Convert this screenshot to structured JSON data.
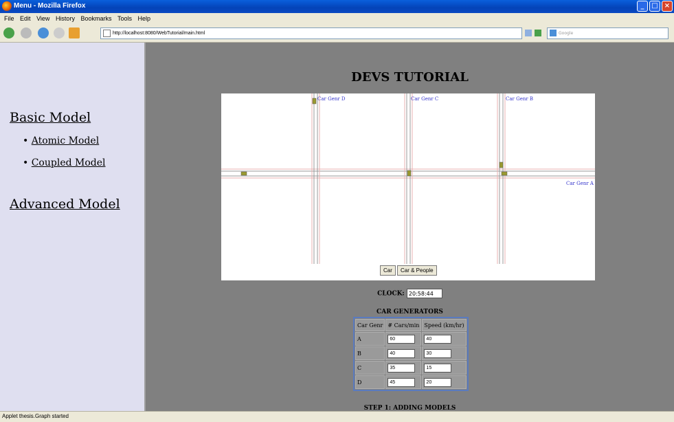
{
  "window": {
    "title": "Menu - Mozilla Firefox"
  },
  "menu": [
    "File",
    "Edit",
    "View",
    "History",
    "Bookmarks",
    "Tools",
    "Help"
  ],
  "nav": {
    "url": "http://localhost:8080/WebTutorial/main.html",
    "search_placeholder": "Google"
  },
  "sidebar": {
    "basic": "Basic Model",
    "items": [
      "Atomic Model",
      "Coupled Model"
    ],
    "advanced": "Advanced Model"
  },
  "main": {
    "title": "DEVS TUTORIAL",
    "generators": {
      "d": "Car Genr D",
      "c": "Car Genr C",
      "b": "Car Genr B",
      "a": "Car Genr A"
    },
    "buttons": {
      "car": "Car",
      "car_people": "Car & People"
    },
    "clock_label": "CLOCK:",
    "clock_value": "20:58:44",
    "car_generators_title": "CAR GENERATORS",
    "table_headers": [
      "Car Genr",
      "# Cars/min",
      "Speed (km/hr)"
    ],
    "table_rows": [
      {
        "genr": "A",
        "cars": "60",
        "speed": "40"
      },
      {
        "genr": "B",
        "cars": "40",
        "speed": "30"
      },
      {
        "genr": "C",
        "cars": "35",
        "speed": "15"
      },
      {
        "genr": "D",
        "cars": "45",
        "speed": "20"
      }
    ],
    "step": "STEP 1: ADDING MODELS"
  },
  "status": {
    "text": "Applet thesis.Graph started"
  }
}
